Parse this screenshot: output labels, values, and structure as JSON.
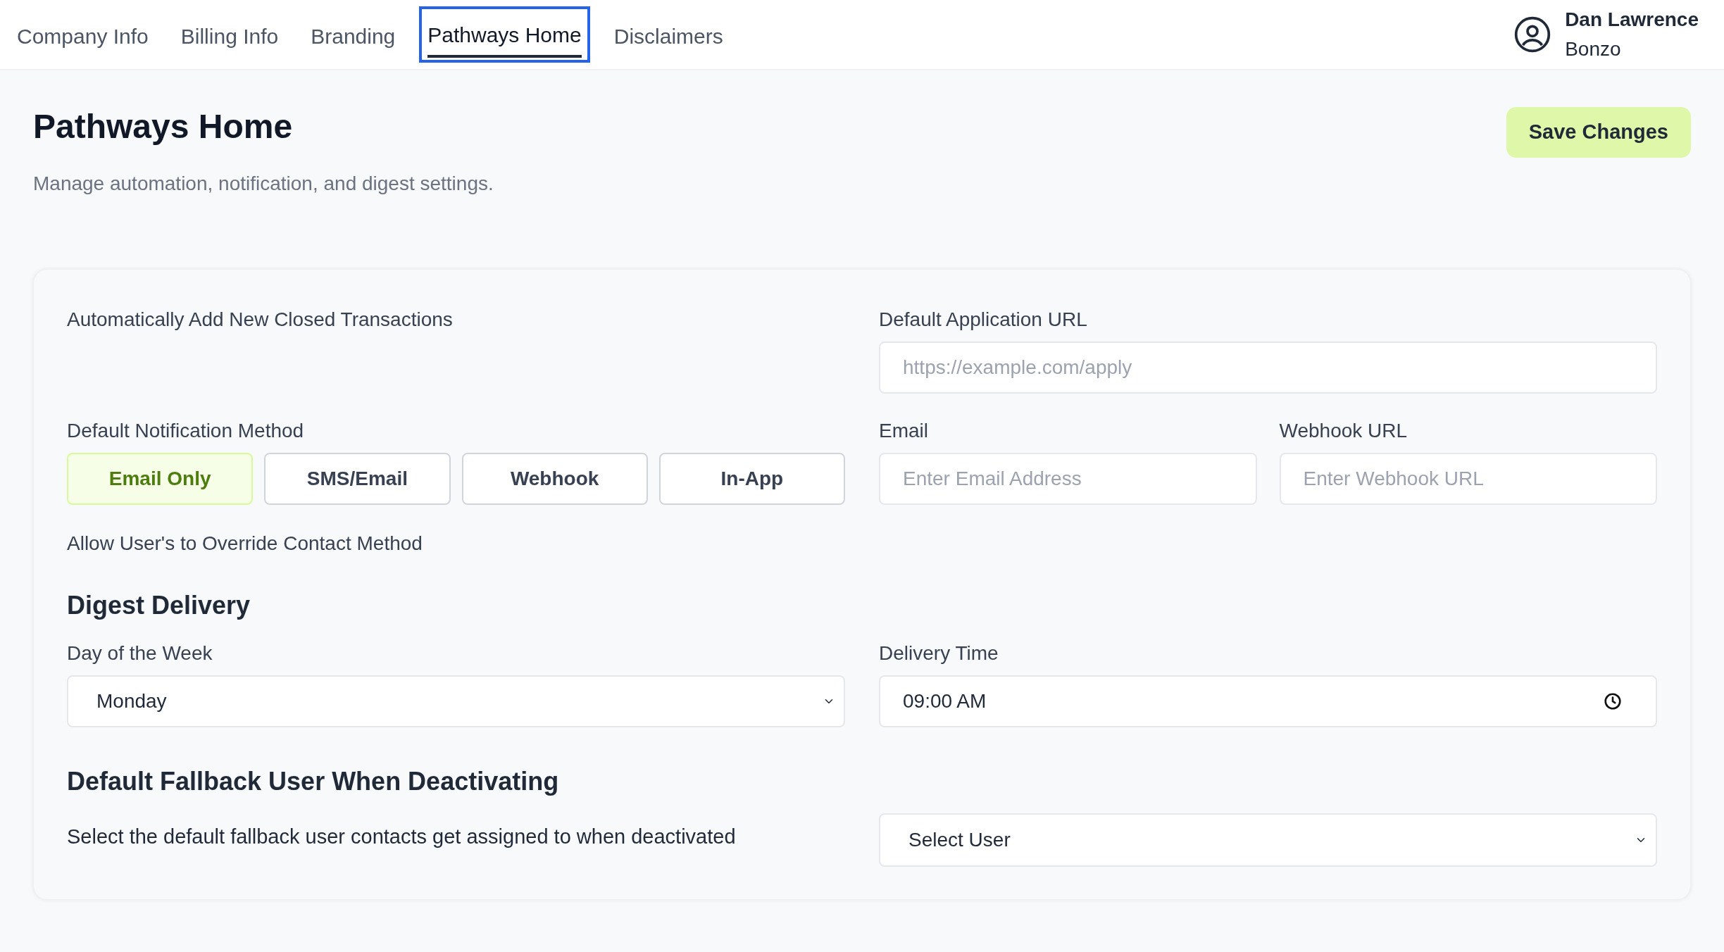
{
  "nav": {
    "tabs": [
      {
        "label": "Company Info",
        "selected": false
      },
      {
        "label": "Billing Info",
        "selected": false
      },
      {
        "label": "Branding",
        "selected": false
      },
      {
        "label": "Pathways Home",
        "selected": true
      },
      {
        "label": "Disclaimers",
        "selected": false
      }
    ],
    "user": {
      "name": "Dan Lawrence",
      "org": "Bonzo"
    }
  },
  "header": {
    "title": "Pathways Home",
    "subtitle": "Manage automation, notification, and digest settings.",
    "save_button": "Save Changes"
  },
  "settings": {
    "auto_add_label": "Automatically Add New Closed Transactions",
    "app_url": {
      "label": "Default Application URL",
      "placeholder": "https://example.com/apply"
    },
    "notification": {
      "label": "Default Notification Method",
      "options": [
        {
          "label": "Email Only",
          "selected": true
        },
        {
          "label": "SMS/Email",
          "selected": false
        },
        {
          "label": "Webhook",
          "selected": false
        },
        {
          "label": "In-App",
          "selected": false
        }
      ]
    },
    "email": {
      "label": "Email",
      "placeholder": "Enter Email Address"
    },
    "webhook": {
      "label": "Webhook URL",
      "placeholder": "Enter Webhook URL"
    },
    "override_label": "Allow User's to Override Contact Method",
    "digest": {
      "heading": "Digest Delivery",
      "day": {
        "label": "Day of the Week",
        "value": "Monday"
      },
      "time": {
        "label": "Delivery Time",
        "value": "09:00 AM"
      }
    },
    "fallback": {
      "heading": "Default Fallback User When Deactivating",
      "description": "Select the default fallback user contacts get assigned to when deactivated",
      "select": {
        "value": "Select User"
      }
    }
  }
}
